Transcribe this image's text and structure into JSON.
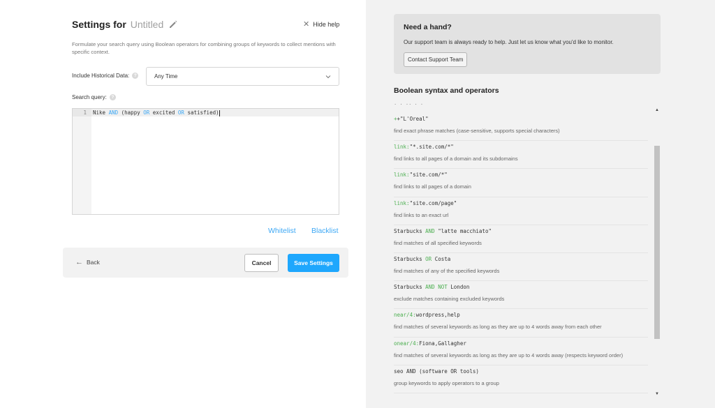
{
  "settings": {
    "title_prefix": "Settings for",
    "title_name": "Untitled",
    "hide_help": "Hide help",
    "description": "Formulate your search query using Boolean operators for combining groups of keywords to collect mentions with specific context.",
    "historical_label": "Include Historical Data:",
    "historical_value": "Any Time",
    "search_query_label": "Search query:",
    "line_number": "1",
    "query_tokens": [
      "Nike ",
      "AND",
      " (happy ",
      "OR",
      " excited ",
      "OR",
      " satisfied)"
    ],
    "whitelist": "Whitelist",
    "blacklist": "Blacklist",
    "back": "Back",
    "cancel": "Cancel",
    "save": "Save Settings",
    "question_mark": "?"
  },
  "help": {
    "title": "Need a hand?",
    "text": "Our support team is always ready to help. Just let us know what you'd like to monitor.",
    "button": "Contact Support Team",
    "syntax_title": "Boolean syntax and operators",
    "clipped_top": "·            ·   ··      ·                  ·",
    "items": [
      {
        "code_parts": [
          [
            "+",
            "g"
          ],
          [
            "+\"L'Oreal\"",
            ""
          ]
        ],
        "desc": "find exact phrase matches (case-sensitive, supports special characters)"
      },
      {
        "code_parts": [
          [
            "link:",
            "g"
          ],
          [
            "\"*.site.com/*\"",
            ""
          ]
        ],
        "desc": "find links to all pages of a domain and its subdomains"
      },
      {
        "code_parts": [
          [
            "link:",
            "g"
          ],
          [
            "\"site.com/*\"",
            ""
          ]
        ],
        "desc": "find links to all pages of a domain"
      },
      {
        "code_parts": [
          [
            "link:",
            "g"
          ],
          [
            "\"site.com/page\"",
            ""
          ]
        ],
        "desc": "find links to an exact url"
      },
      {
        "code_parts": [
          [
            "Starbucks ",
            ""
          ],
          [
            "AND",
            "g"
          ],
          [
            " \"latte macchiato\"",
            ""
          ]
        ],
        "desc": "find matches of all specified keywords"
      },
      {
        "code_parts": [
          [
            "Starbucks ",
            ""
          ],
          [
            "OR",
            "g"
          ],
          [
            " Costa",
            ""
          ]
        ],
        "desc": "find matches of any of the specified keywords"
      },
      {
        "code_parts": [
          [
            "Starbucks ",
            ""
          ],
          [
            "AND NOT",
            "g"
          ],
          [
            " London",
            ""
          ]
        ],
        "desc": "exclude matches containing excluded keywords"
      },
      {
        "code_parts": [
          [
            "near/4:",
            "g"
          ],
          [
            "wordpress,help",
            ""
          ]
        ],
        "desc": "find matches of several keywords as long as they are up to 4 words away from each other"
      },
      {
        "code_parts": [
          [
            "onear/4:",
            "g"
          ],
          [
            "Fiona,Gallagher",
            ""
          ]
        ],
        "desc": "find matches of several keywords as long as they are up to 4 words away (respects keyword order)"
      },
      {
        "code_parts": [
          [
            "seo AND (software OR tools)",
            ""
          ]
        ],
        "desc": "group keywords to apply operators to a group"
      }
    ]
  },
  "colors": {
    "accent": "#1ea7fd",
    "keyword_blue": "#3da8f5",
    "operator_green": "#4caf50"
  }
}
